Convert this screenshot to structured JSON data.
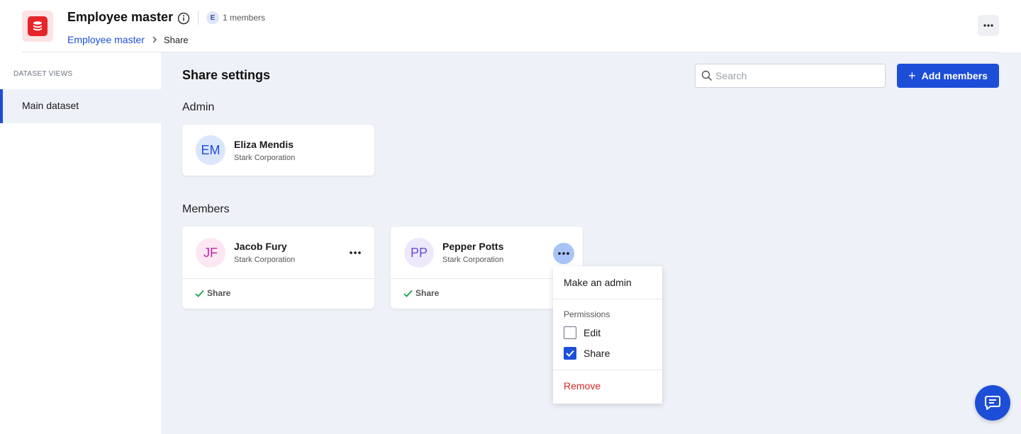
{
  "header": {
    "title": "Employee master",
    "member_initial": "E",
    "members_count": "1 members",
    "breadcrumb": {
      "link": "Employee master",
      "current": "Share"
    }
  },
  "sidebar": {
    "heading": "DATASET VIEWS",
    "items": [
      {
        "label": "Main dataset",
        "active": true
      }
    ]
  },
  "main": {
    "title": "Share settings",
    "search": {
      "placeholder": "Search",
      "value": ""
    },
    "add_button": "Add members",
    "admin_section": {
      "label": "Admin",
      "person": {
        "initials": "EM",
        "name": "Eliza Mendis",
        "org": "Stark Corporation"
      }
    },
    "members_section": {
      "label": "Members",
      "members": [
        {
          "initials": "JF",
          "name": "Jacob Fury",
          "org": "Stark Corporation",
          "permission": "Share"
        },
        {
          "initials": "PP",
          "name": "Pepper Potts",
          "org": "Stark Corporation",
          "permission": "Share"
        }
      ]
    }
  },
  "menu": {
    "make_admin": "Make an admin",
    "permissions_label": "Permissions",
    "options": [
      {
        "label": "Edit",
        "checked": false
      },
      {
        "label": "Share",
        "checked": true
      }
    ],
    "remove": "Remove"
  },
  "colors": {
    "accent": "#1d4ed8",
    "danger": "#dc2626",
    "success": "#16a34a",
    "app_icon": "#e5252a"
  }
}
